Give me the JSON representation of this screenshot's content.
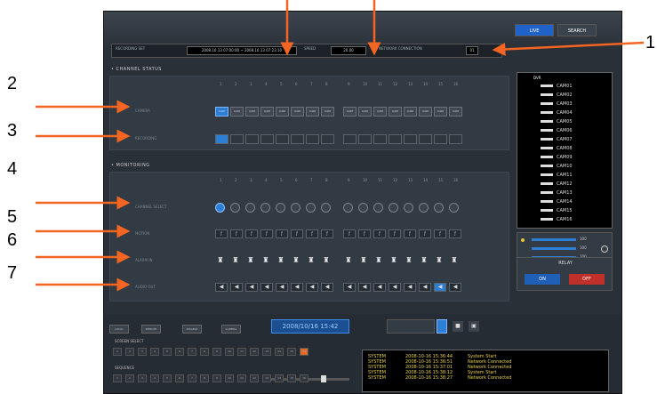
{
  "callouts": [
    {
      "id": "1",
      "label": "1"
    },
    {
      "id": "2",
      "label": "2"
    },
    {
      "id": "3",
      "label": "3"
    },
    {
      "id": "4",
      "label": "4"
    },
    {
      "id": "5",
      "label": "5"
    },
    {
      "id": "6",
      "label": "6"
    },
    {
      "id": "7",
      "label": "7"
    }
  ],
  "tabs": {
    "live": "LIVE",
    "search": "SEARCH"
  },
  "info_bar": {
    "recording_label": "RECORDING SET",
    "recording_value": "2008.10.13 07:00:00 ~ 2008.10.13 07:23:10",
    "speed_label": "SPEED",
    "speed_value": "20.00",
    "network_label": "NETWORK CONNECTION",
    "network_value": "01"
  },
  "sections": {
    "channel_status": "• CHANNEL STATUS",
    "monitoring": "• MONITORING"
  },
  "rows": {
    "camera": "CAMERA",
    "recording": "RECORDING",
    "channel_select": "CHANNEL SELECT",
    "motion": "MOTION",
    "alarm_in": "ALARM IN",
    "audio": "AUDIO OUT"
  },
  "channel_numbers": [
    "1",
    "2",
    "3",
    "4",
    "5",
    "6",
    "7",
    "8",
    "9",
    "10",
    "11",
    "12",
    "13",
    "14",
    "15",
    "16"
  ],
  "cam_button_label": "CAM",
  "camera_list": {
    "root": "DVR",
    "items": [
      "CAM01",
      "CAM02",
      "CAM03",
      "CAM04",
      "CAM05",
      "CAM06",
      "CAM07",
      "CAM08",
      "CAM09",
      "CAM10",
      "CAM11",
      "CAM12",
      "CAM13",
      "CAM14",
      "CAM15",
      "CAM16"
    ]
  },
  "ptz": {
    "rows": [
      "100",
      "100",
      "100"
    ]
  },
  "relay": {
    "title": "RELAY",
    "on": "ON",
    "off": "OFF"
  },
  "bottom": {
    "buttons": [
      "LOCAL",
      "REMOTE",
      "DISABLE",
      "CAMERA"
    ],
    "datetime": "2008/10/16 15:42 ",
    "channels_title": "SCREEN SELECT",
    "sequence_title": "SEQUENCE",
    "seq_numbers": [
      "1",
      "2",
      "3",
      "4",
      "5",
      "6",
      "7",
      "8",
      "9",
      "10",
      "11",
      "12",
      "13",
      "14",
      "15",
      "16"
    ]
  },
  "log": [
    {
      "source": "SYSTEM",
      "time": "2008-10-16 15:36:44",
      "event": "System Start"
    },
    {
      "source": "SYSTEM",
      "time": "2008-10-16 15:36:51",
      "event": "Network Connected"
    },
    {
      "source": "SYSTEM",
      "time": "2008-10-16 15:37:01",
      "event": "Network Connected"
    },
    {
      "source": "SYSTEM",
      "time": "2008-10-16 15:38:12",
      "event": "System Start"
    },
    {
      "source": "SYSTEM",
      "time": "2008-10-16 15:38:27",
      "event": "Network Connected"
    }
  ],
  "colors": {
    "callout_arrow": "#f26522",
    "accent_blue": "#2d7fd6",
    "relay_on": "#1f5fb8",
    "relay_off": "#c0302a"
  }
}
